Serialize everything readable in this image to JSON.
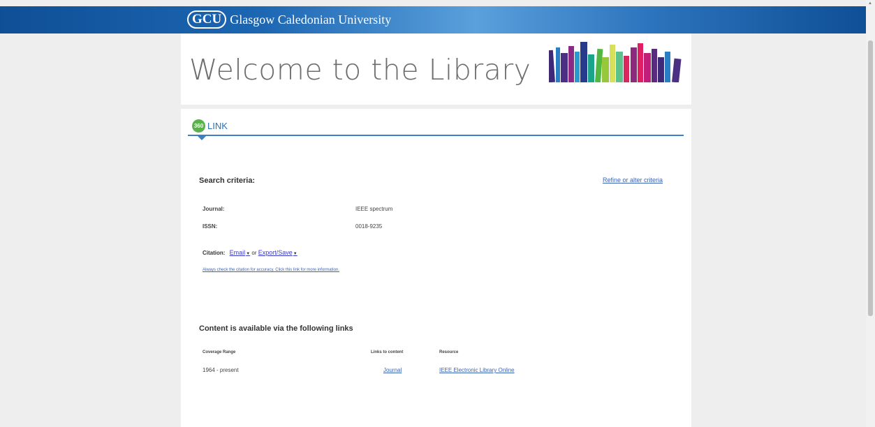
{
  "header": {
    "logo_badge": "GCU",
    "university_name": "Glasgow Caledonian University"
  },
  "banner": {
    "title": "Welcome to the Library",
    "book_colors": [
      "#3f2a7a",
      "#2a7fc4",
      "#4a2f82",
      "#8a2a86",
      "#2a9ad0",
      "#273a8c",
      "#1aa58a",
      "#53b843",
      "#97c83c",
      "#d6e05a",
      "#5cc18a",
      "#d9265d",
      "#8c2a7e",
      "#e01e66",
      "#c01e78",
      "#5a2a7e"
    ]
  },
  "service": {
    "badge": "360",
    "name": "LINK"
  },
  "search_criteria": {
    "title": "Search criteria:",
    "refine_link": "Refine or alter criteria",
    "fields": [
      {
        "label": "Journal:",
        "value": "IEEE spectrum"
      },
      {
        "label": "ISSN:",
        "value": "0018-9235"
      }
    ]
  },
  "citation": {
    "label": "Citation:",
    "email": "Email",
    "or_text": "or",
    "export": "Export/Save",
    "accuracy_note": "Always check the citation for accuracy. Click this link for more information."
  },
  "content": {
    "title": "Content is available via the following links",
    "columns": [
      "Coverage Range",
      "Links to content",
      "Resource"
    ],
    "rows": [
      {
        "coverage": "1964 - present",
        "link": "Journal",
        "resource": "IEEE Electronic Library Online"
      }
    ]
  }
}
